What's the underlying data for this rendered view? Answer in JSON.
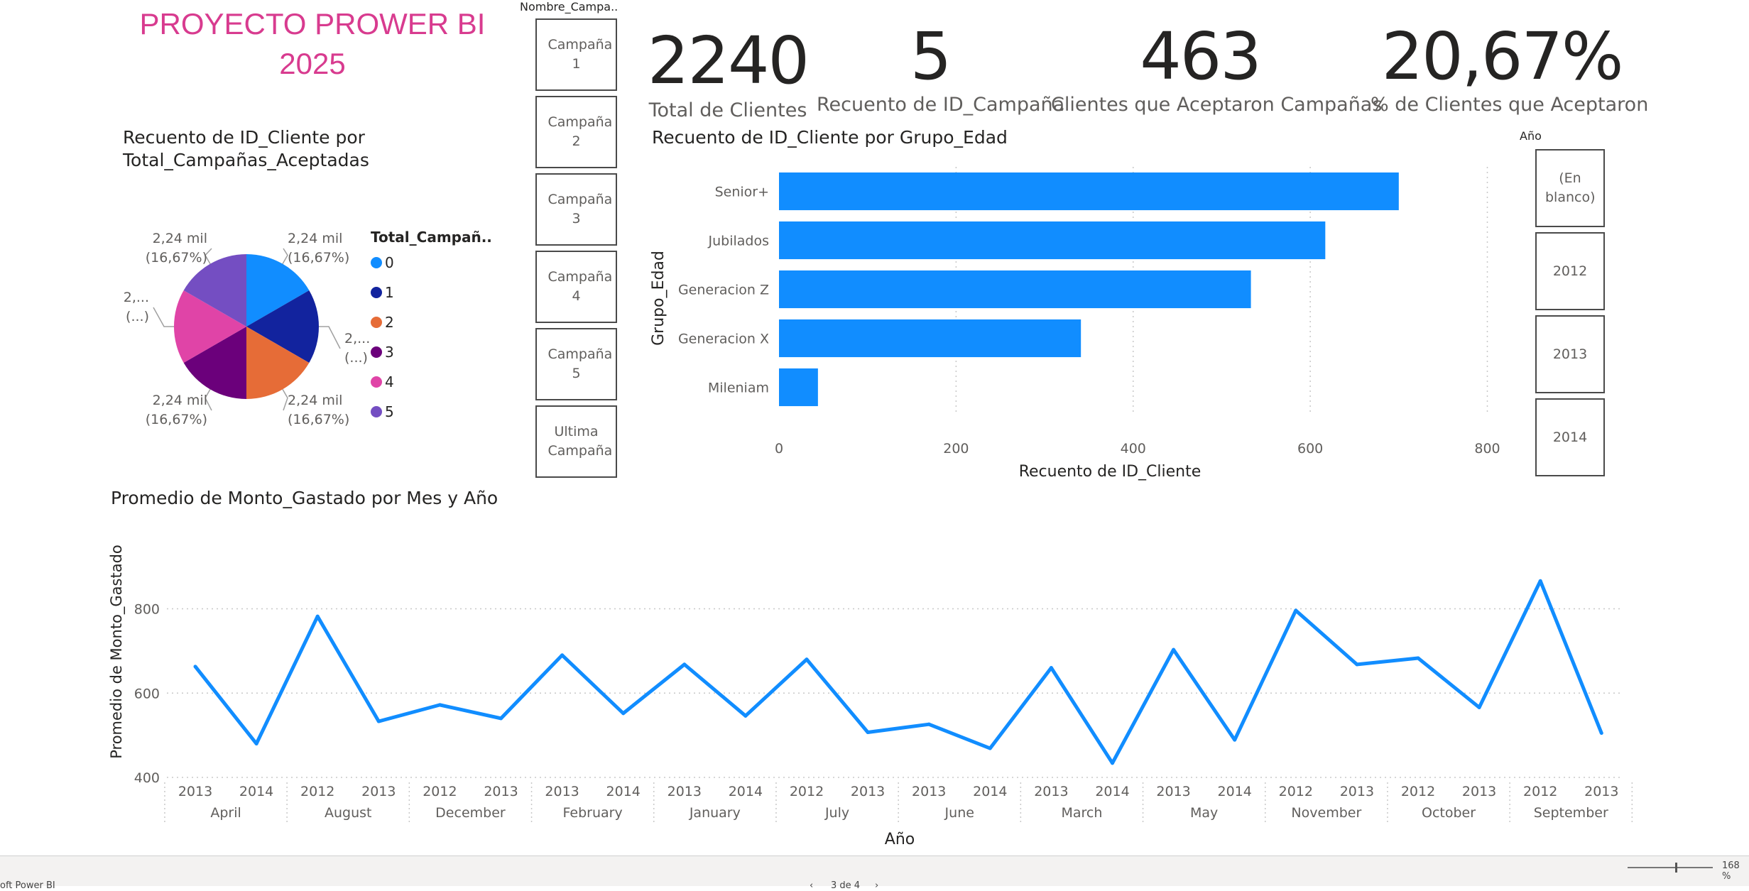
{
  "report_title": "PROYECTO PROWER BI 2025",
  "campaign_slicer": {
    "header": "Nombre_Campa...",
    "items": [
      "Campaña 1",
      "Campaña 2",
      "Campaña 3",
      "Campaña 4",
      "Campaña 5",
      "Ultima Campaña"
    ]
  },
  "year_slicer": {
    "header": "Año",
    "items": [
      "(En blanco)",
      "2012",
      "2013",
      "2014"
    ]
  },
  "kpis": [
    {
      "value": "2240",
      "label": "Total de Clientes"
    },
    {
      "value": "5",
      "label": "Recuento de ID_Campaña"
    },
    {
      "value": "463",
      "label": "Clientes que Aceptaron Campañas"
    },
    {
      "value": "20,67%",
      "label": "% de Clientes que Aceptaron"
    }
  ],
  "colors": {
    "title": "#d83b8f",
    "bar": "#118dff",
    "line": "#118dff",
    "pie": [
      "#118dff",
      "#12239e",
      "#e66c37",
      "#6b007b",
      "#e044a7",
      "#744ec2"
    ]
  },
  "statusbar": {
    "app": "oft Power BI",
    "page": "3 de 4",
    "zoom": "168 %"
  },
  "chart_data": [
    {
      "type": "pie",
      "title": "Recuento de ID_Cliente por Total_Campañas_Aceptadas",
      "legend_title": "Total_Campañ...",
      "legend_position": "right",
      "categories": [
        "0",
        "1",
        "2",
        "3",
        "4",
        "5"
      ],
      "values": [
        2240,
        2240,
        2240,
        2240,
        2240,
        2240
      ],
      "labels": [
        {
          "l1": "2,24 mil",
          "l2": "(16,67%)"
        },
        {
          "l1": "2,...",
          "l2": "(...)"
        },
        {
          "l1": "2,24 mil",
          "l2": "(16,67%)"
        },
        {
          "l1": "2,24 mil",
          "l2": "(16,67%)"
        },
        {
          "l1": "2,...",
          "l2": "(...)"
        },
        {
          "l1": "2,24 mil",
          "l2": "(16,67%)"
        }
      ]
    },
    {
      "type": "bar",
      "orientation": "horizontal",
      "title": "Recuento de ID_Cliente por Grupo_Edad",
      "xlabel": "Recuento de ID_Cliente",
      "ylabel": "Grupo_Edad",
      "categories": [
        "Senior+",
        "Jubilados",
        "Generacion Z",
        "Generacion X",
        "Mileniam"
      ],
      "values": [
        700,
        617,
        533,
        341,
        44
      ],
      "xlim": [
        0,
        800
      ],
      "xticks": [
        "0",
        "200",
        "400",
        "600",
        "800"
      ],
      "grid": true
    },
    {
      "type": "line",
      "title": "Promedio de Monto_Gastado por Mes y Año",
      "xlabel": "Año",
      "ylabel": "Promedio de Monto_Gastado",
      "ylim": [
        400,
        880
      ],
      "yticks": [
        "400",
        "600",
        "800"
      ],
      "x": [
        {
          "year": "2013",
          "month": "April"
        },
        {
          "year": "2014",
          "month": "April"
        },
        {
          "year": "2012",
          "month": "August"
        },
        {
          "year": "2013",
          "month": "August"
        },
        {
          "year": "2012",
          "month": "December"
        },
        {
          "year": "2013",
          "month": "December"
        },
        {
          "year": "2013",
          "month": "February"
        },
        {
          "year": "2014",
          "month": "February"
        },
        {
          "year": "2013",
          "month": "January"
        },
        {
          "year": "2014",
          "month": "January"
        },
        {
          "year": "2012",
          "month": "July"
        },
        {
          "year": "2013",
          "month": "July"
        },
        {
          "year": "2013",
          "month": "June"
        },
        {
          "year": "2014",
          "month": "June"
        },
        {
          "year": "2013",
          "month": "March"
        },
        {
          "year": "2014",
          "month": "March"
        },
        {
          "year": "2013",
          "month": "May"
        },
        {
          "year": "2014",
          "month": "May"
        },
        {
          "year": "2012",
          "month": "November"
        },
        {
          "year": "2013",
          "month": "November"
        },
        {
          "year": "2012",
          "month": "October"
        },
        {
          "year": "2013",
          "month": "October"
        },
        {
          "year": "2012",
          "month": "September"
        },
        {
          "year": "2013",
          "month": "September"
        }
      ],
      "months": [
        "April",
        "August",
        "December",
        "February",
        "January",
        "July",
        "June",
        "March",
        "May",
        "November",
        "October",
        "September"
      ],
      "values": [
        663,
        480,
        782,
        533,
        572,
        540,
        690,
        552,
        668,
        546,
        680,
        507,
        526,
        469,
        660,
        434,
        703,
        489,
        796,
        668,
        683,
        566,
        866,
        505
      ],
      "grid": true
    }
  ]
}
